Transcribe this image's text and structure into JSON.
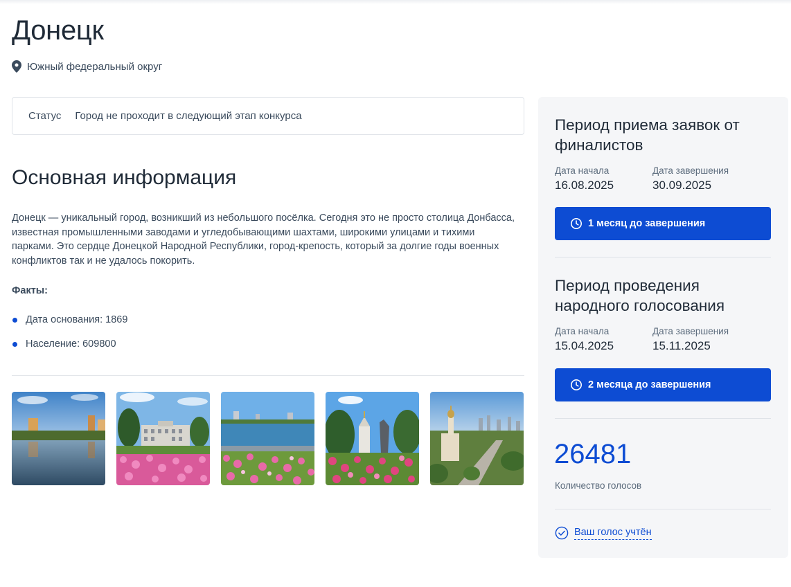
{
  "city": {
    "name": "Донецк",
    "region": "Южный федеральный округ"
  },
  "status": {
    "label": "Статус",
    "value": "Город не проходит в следующий этап конкурса"
  },
  "info": {
    "title": "Основная информация",
    "description": "Донецк — уникальный город, возникший из небольшого посёлка. Сегодня это не просто столица Донбасса, известная промышленными заводами и угледобывающими шахтами, широкими улицами и тихими парками. Это сердце Донецкой Народной Республики, город-крепость, который за долгие годы военных конфликтов так и не удалось покорить.",
    "facts_title": "Факты:",
    "facts": [
      "Дата основания: 1869",
      "Население: 609800"
    ]
  },
  "gallery": [
    {
      "icon": "photo-embankment-reflection"
    },
    {
      "icon": "photo-administration-building"
    },
    {
      "icon": "photo-pond-with-flowers"
    },
    {
      "icon": "photo-chapel-monument"
    },
    {
      "icon": "photo-cathedral-panorama"
    }
  ],
  "sidebar": {
    "period1": {
      "title": "Период приема заявок от финалистов",
      "start_label": "Дата начала",
      "start_value": "16.08.2025",
      "end_label": "Дата завершения",
      "end_value": "30.09.2025",
      "button": "1 месяц до завершения"
    },
    "period2": {
      "title": "Период проведения народного голосования",
      "start_label": "Дата начала",
      "start_value": "15.04.2025",
      "end_label": "Дата завершения",
      "end_value": "15.11.2025",
      "button": "2 месяца до завершения"
    },
    "votes": {
      "count": "26481",
      "label": "Количество голосов"
    },
    "voted": "Ваш голос учтён"
  },
  "colors": {
    "accent": "#0d4cd3",
    "text": "#1f2a37",
    "muted": "#5b6b7c",
    "sidebar_bg": "#f5f6f8"
  }
}
